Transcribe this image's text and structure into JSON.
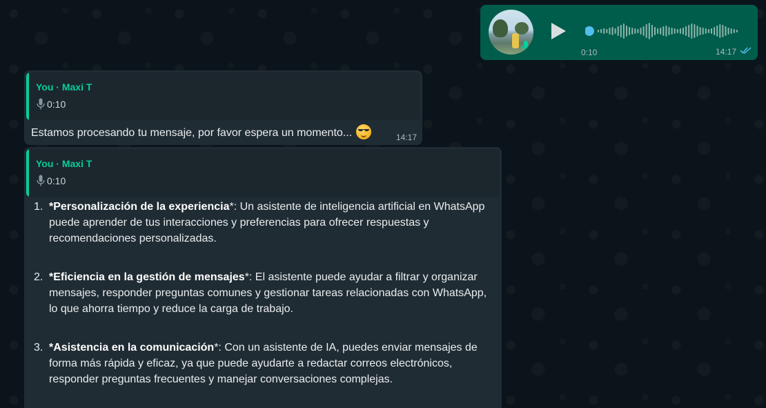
{
  "voice_message": {
    "duration": "0:10",
    "time": "14:17"
  },
  "messages": [
    {
      "quote_author": "You · Maxi T",
      "quote_duration": "0:10",
      "text": "Estamos procesando tu mensaje, por favor espera un momento...",
      "time": "14:17"
    },
    {
      "quote_author": "You · Maxi T",
      "quote_duration": "0:10",
      "items": [
        {
          "num": "1.",
          "pre": "*",
          "bold": "Personalización de la experiencia",
          "rest": "*: Un asistente de inteligencia artificial en WhatsApp puede aprender de tus interacciones y preferencias para ofrecer respuestas y recomendaciones personalizadas."
        },
        {
          "num": "2.",
          "pre": "*",
          "bold": "Eficiencia en la gestión de mensajes",
          "rest": "*: El asistente puede ayudar a filtrar y organizar mensajes, responder preguntas comunes y gestionar tareas relacionadas con WhatsApp, lo que ahorra tiempo y reduce la carga de trabajo."
        },
        {
          "num": "3.",
          "pre": "*",
          "bold": "Asistencia en la comunicación",
          "rest": "*: Con un asistente de IA, puedes enviar mensajes de forma más rápida y eficaz, ya que puede ayudarte a redactar correos electrónicos, responder preguntas frecuentes y manejar conversaciones complejas."
        }
      ]
    }
  ],
  "colors": {
    "background": "#0b141a",
    "outgoing_bubble": "#005c4b",
    "incoming_bubble": "#202c33",
    "accent": "#06cf9c",
    "read_ticks": "#53bdeb"
  }
}
